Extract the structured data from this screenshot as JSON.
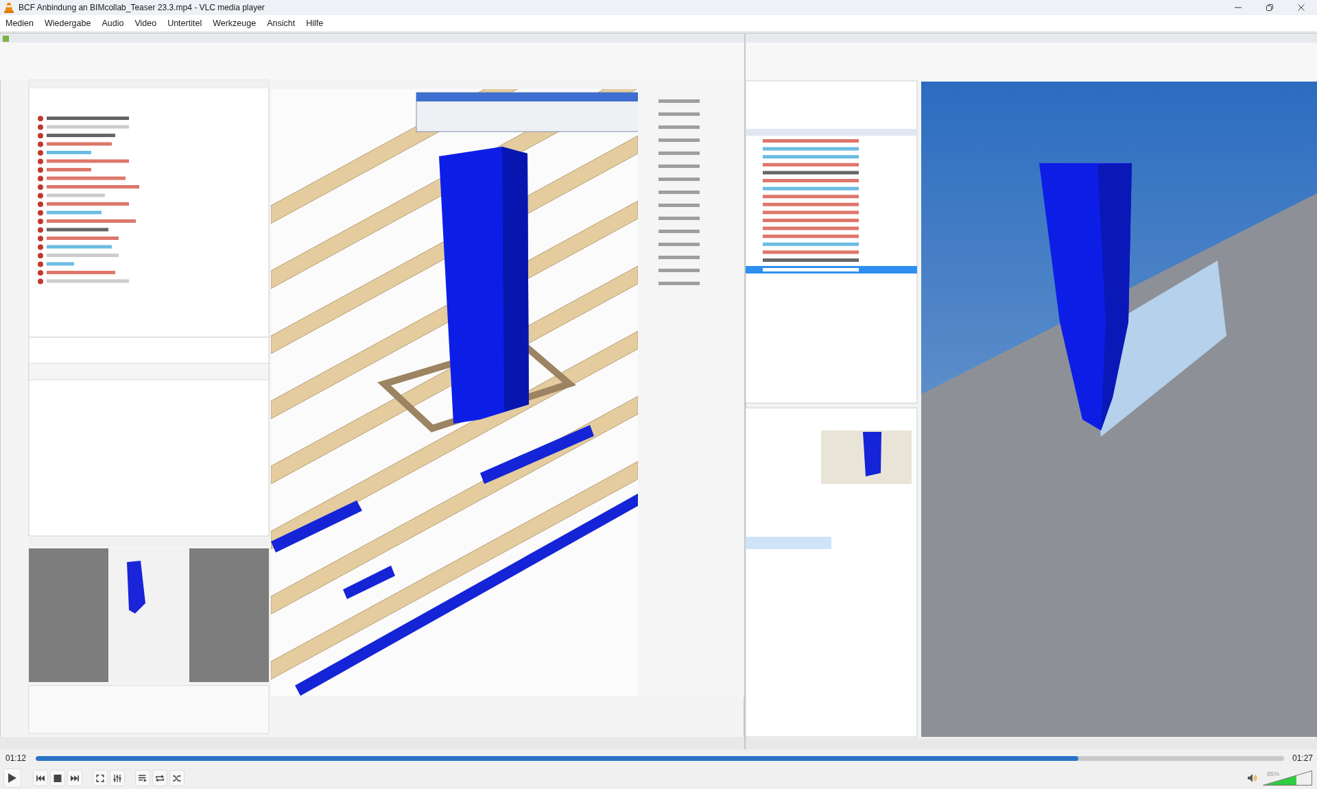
{
  "window": {
    "title": "BCF Anbindung an BIMcollab_Teaser 23.3.mp4 - VLC media player"
  },
  "menu": [
    "Medien",
    "Wiedergabe",
    "Audio",
    "Video",
    "Untertitel",
    "Werkzeuge",
    "Ansicht",
    "Hilfe"
  ],
  "playback": {
    "elapsed": "01:12",
    "total": "01:27",
    "level": 0.835,
    "playing": false
  },
  "volume": {
    "label": "85%",
    "level": 0.68
  }
}
